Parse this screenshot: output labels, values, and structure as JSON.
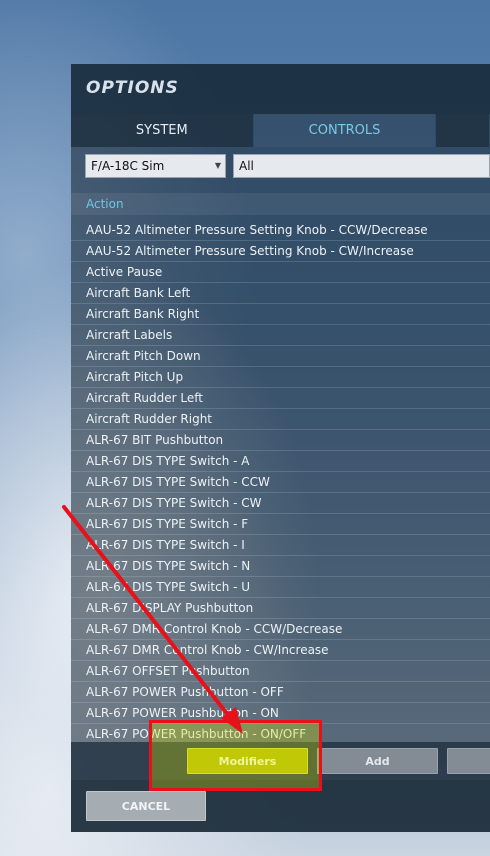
{
  "window": {
    "title": "OPTIONS"
  },
  "tabs": [
    {
      "label": "SYSTEM",
      "active": false
    },
    {
      "label": "CONTROLS",
      "active": true
    }
  ],
  "filters": {
    "aircraft": "F/A-18C Sim",
    "category": "All"
  },
  "table": {
    "column_header": "Action",
    "rows": [
      "AAU-52 Altimeter Pressure Setting Knob - CCW/Decrease",
      "AAU-52 Altimeter Pressure Setting Knob - CW/Increase",
      "Active Pause",
      "Aircraft Bank Left",
      "Aircraft Bank Right",
      "Aircraft Labels",
      "Aircraft Pitch Down",
      "Aircraft Pitch Up",
      "Aircraft Rudder Left",
      "Aircraft Rudder Right",
      "ALR-67 BIT Pushbutton",
      "ALR-67 DIS TYPE Switch - A",
      "ALR-67 DIS TYPE Switch - CCW",
      "ALR-67 DIS TYPE Switch - CW",
      "ALR-67 DIS TYPE Switch - F",
      "ALR-67 DIS TYPE Switch - I",
      "ALR-67 DIS TYPE Switch - N",
      "ALR-67 DIS TYPE Switch - U",
      "ALR-67 DISPLAY Pushbutton",
      "ALR-67 DMR Control Knob - CCW/Decrease",
      "ALR-67 DMR Control Knob - CW/Increase",
      "ALR-67 OFFSET Pushbutton",
      "ALR-67 POWER Pushbutton - OFF",
      "ALR-67 POWER Pushbutton - ON",
      "ALR-67 POWER Pushbutton - ON/OFF"
    ]
  },
  "buttons": {
    "modifiers": "Modifiers",
    "add": "Add",
    "cancel": "CANCEL"
  },
  "colors": {
    "accent": "#7cc8e6",
    "highlight_border": "#e8111a",
    "modifiers_button": "#b8bf0a"
  },
  "icons": {
    "dropdown": "chevron-down-icon",
    "annotation": "red-arrow"
  }
}
